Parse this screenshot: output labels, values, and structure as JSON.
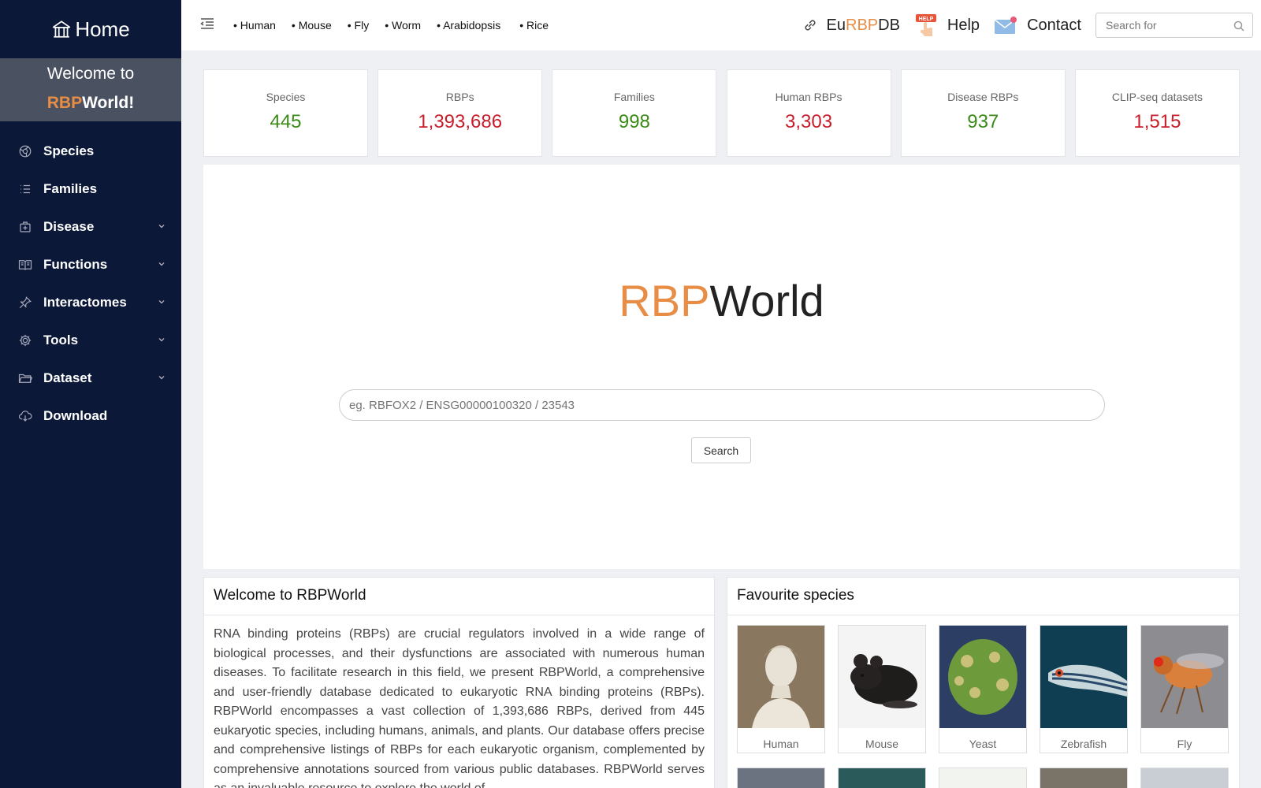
{
  "sidebar": {
    "home_label": "Home",
    "welcome_line1": "Welcome to",
    "welcome_brand_a": "RBP",
    "welcome_brand_b": "World!",
    "items": [
      {
        "label": "Species",
        "icon": "species-icon",
        "expandable": false
      },
      {
        "label": "Families",
        "icon": "list-icon",
        "expandable": false
      },
      {
        "label": "Disease",
        "icon": "medkit-icon",
        "expandable": true
      },
      {
        "label": "Functions",
        "icon": "book-icon",
        "expandable": true
      },
      {
        "label": "Interactomes",
        "icon": "pin-icon",
        "expandable": true
      },
      {
        "label": "Tools",
        "icon": "gear-icon",
        "expandable": true
      },
      {
        "label": "Dataset",
        "icon": "folder-icon",
        "expandable": true
      },
      {
        "label": "Download",
        "icon": "cloud-download-icon",
        "expandable": false
      }
    ]
  },
  "topbar": {
    "species_links": [
      "• Human",
      "• Mouse",
      "• Fly",
      "• Worm",
      "• Arabidopsis",
      "• Rice"
    ],
    "eurbpdb_a": "Eu",
    "eurbpdb_b": "RBP",
    "eurbpdb_c": "DB",
    "help_label": "Help",
    "help_badge": "HELP",
    "contact_label": "Contact",
    "search_placeholder": "Search for"
  },
  "stats": [
    {
      "label": "Species",
      "value": "445",
      "color": "#3b8a16"
    },
    {
      "label": "RBPs",
      "value": "1,393,686",
      "color": "#c81d2b"
    },
    {
      "label": "Families",
      "value": "998",
      "color": "#3b8a16"
    },
    {
      "label": "Human RBPs",
      "value": "3,303",
      "color": "#c81d2b"
    },
    {
      "label": "Disease RBPs",
      "value": "937",
      "color": "#3b8a16"
    },
    {
      "label": "CLIP-seq datasets",
      "value": "1,515",
      "color": "#c81d2b"
    }
  ],
  "hero": {
    "title_a": "RBP",
    "title_b": "World",
    "search_placeholder": "eg. RBFOX2 / ENSG00000100320 / 23543",
    "search_button": "Search"
  },
  "welcome_panel": {
    "title": "Welcome to RBPWorld",
    "text": "RNA binding proteins (RBPs) are crucial regulators involved in a wide range of biological processes, and their dysfunctions are associated with numerous human diseases. To facilitate research in this field, we present RBPWorld, a comprehensive and user-friendly database dedicated to eukaryotic RNA binding proteins (RBPs). RBPWorld encompasses a vast collection of 1,393,686 RBPs, derived from 445 eukaryotic species, including humans, animals, and plants. Our database offers precise and comprehensive listings of RBPs for each eukaryotic organism, complemented by comprehensive annotations sourced from various public databases. RBPWorld serves as an invaluable resource to explore the world of"
  },
  "favourite_panel": {
    "title": "Favourite species",
    "species": [
      {
        "name": "Human"
      },
      {
        "name": "Mouse"
      },
      {
        "name": "Yeast"
      },
      {
        "name": "Zebrafish"
      },
      {
        "name": "Fly"
      }
    ]
  },
  "colors": {
    "sidebar_bg": "#0b1838",
    "accent_orange": "#e88d45",
    "stat_green": "#3b8a16",
    "stat_red": "#c81d2b"
  }
}
